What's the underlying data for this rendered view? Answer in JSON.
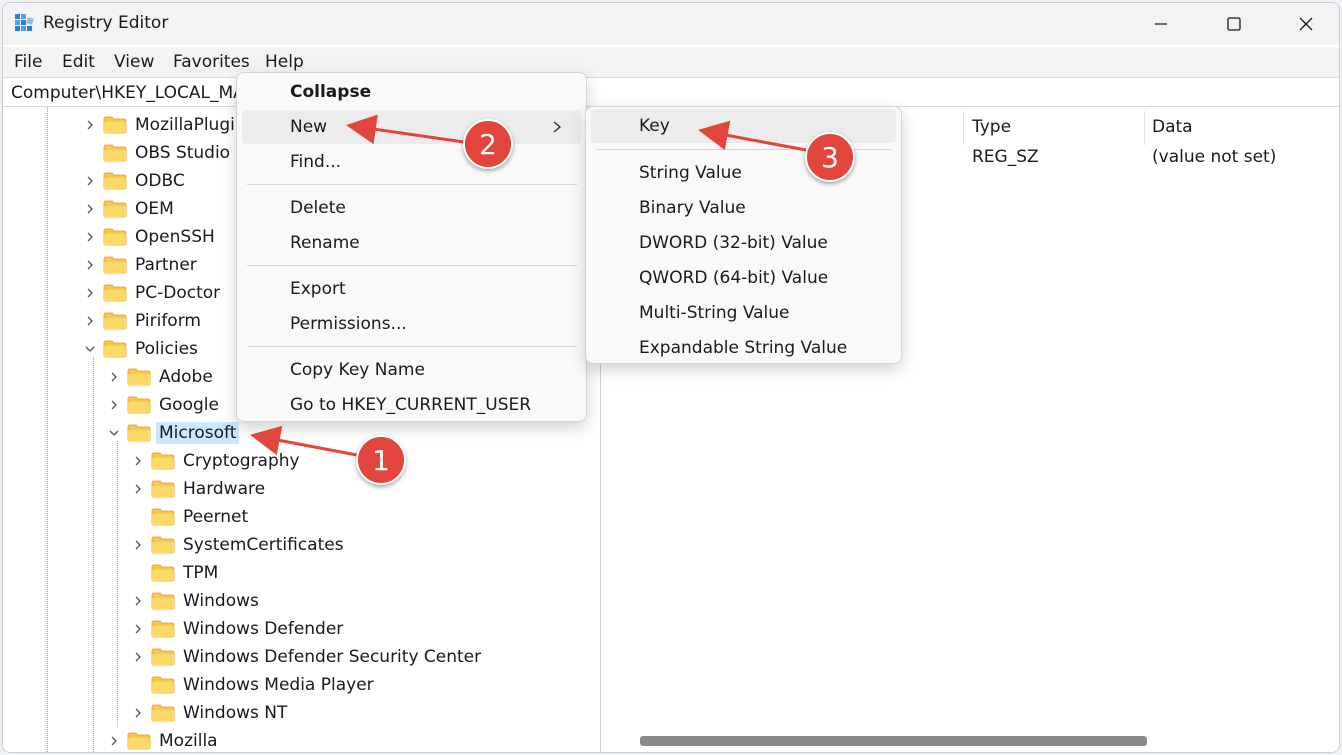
{
  "window": {
    "title": "Registry Editor",
    "controls": {
      "minimize": "minimize-icon",
      "maximize": "maximize-icon",
      "close": "close-icon"
    }
  },
  "menubar": [
    "File",
    "Edit",
    "View",
    "Favorites",
    "Help"
  ],
  "address": "Computer\\HKEY_LOCAL_MA",
  "tree": {
    "items": [
      {
        "label": "MozillaPlugir",
        "expander": "collapsed"
      },
      {
        "label": "OBS Studio",
        "expander": "none"
      },
      {
        "label": "ODBC",
        "expander": "collapsed"
      },
      {
        "label": "OEM",
        "expander": "collapsed"
      },
      {
        "label": "OpenSSH",
        "expander": "collapsed"
      },
      {
        "label": "Partner",
        "expander": "collapsed"
      },
      {
        "label": "PC-Doctor",
        "expander": "collapsed"
      },
      {
        "label": "Piriform",
        "expander": "collapsed"
      },
      {
        "label": "Policies",
        "expander": "expanded"
      },
      {
        "label": "Adobe",
        "expander": "collapsed"
      },
      {
        "label": "Google",
        "expander": "collapsed"
      },
      {
        "label": "Microsoft",
        "expander": "expanded",
        "selected": true
      },
      {
        "label": "Cryptography",
        "expander": "collapsed"
      },
      {
        "label": "Hardware",
        "expander": "collapsed"
      },
      {
        "label": "Peernet",
        "expander": "none"
      },
      {
        "label": "SystemCertificates",
        "expander": "collapsed"
      },
      {
        "label": "TPM",
        "expander": "none"
      },
      {
        "label": "Windows",
        "expander": "collapsed"
      },
      {
        "label": "Windows Defender",
        "expander": "collapsed"
      },
      {
        "label": "Windows Defender Security Center",
        "expander": "collapsed"
      },
      {
        "label": "Windows Media Player",
        "expander": "none"
      },
      {
        "label": "Windows NT",
        "expander": "collapsed"
      },
      {
        "label": "Mozilla",
        "expander": "collapsed"
      }
    ]
  },
  "values": {
    "columns": [
      "Type",
      "Data"
    ],
    "rows": [
      {
        "type": "REG_SZ",
        "data": "(value not set)"
      }
    ]
  },
  "context_menu": {
    "items": [
      "Collapse",
      "New",
      "Find...",
      "Delete",
      "Rename",
      "Export",
      "Permissions...",
      "Copy Key Name",
      "Go to HKEY_CURRENT_USER"
    ]
  },
  "new_submenu": {
    "items": [
      "Key",
      "String Value",
      "Binary Value",
      "DWORD (32-bit) Value",
      "QWORD (64-bit) Value",
      "Multi-String Value",
      "Expandable String Value"
    ]
  },
  "annotations": {
    "badges": [
      "1",
      "2",
      "3"
    ],
    "color": "#e2453b"
  },
  "colors": {
    "folder": "#f7c948",
    "selection": "#cce8ff",
    "menu_hover": "#ececec"
  }
}
